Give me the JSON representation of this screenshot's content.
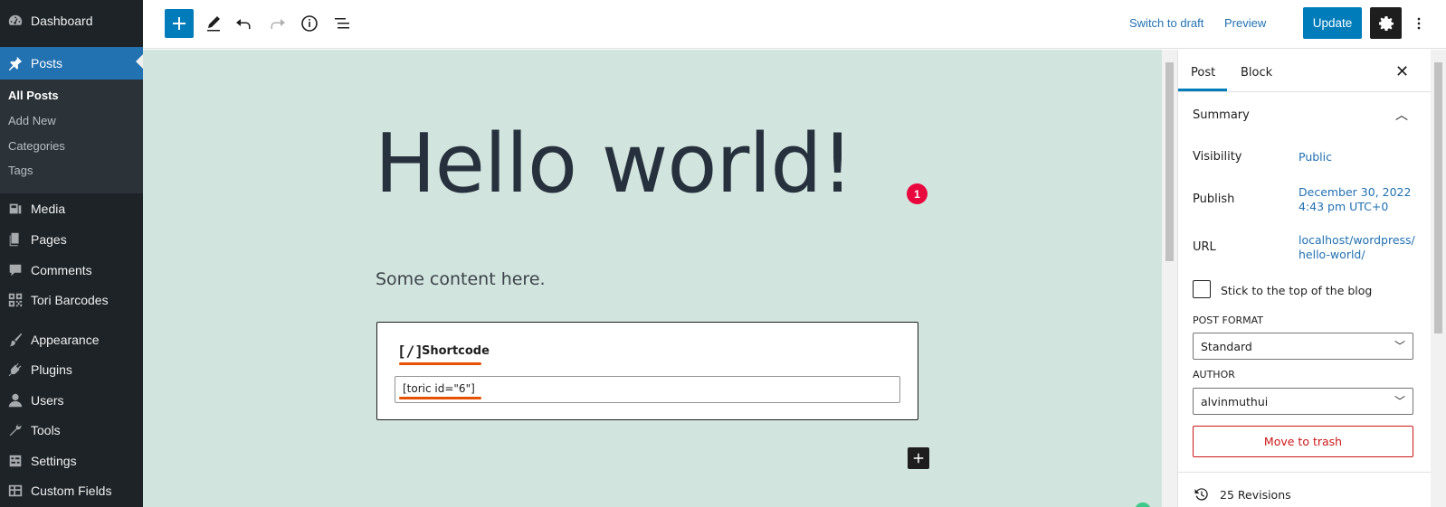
{
  "admin_menu": {
    "items": [
      {
        "label": "Dashboard",
        "icon": "dashboard-icon"
      },
      {
        "label": "Posts",
        "icon": "pin-icon"
      },
      {
        "label": "Media",
        "icon": "media-icon"
      },
      {
        "label": "Pages",
        "icon": "pages-icon"
      },
      {
        "label": "Comments",
        "icon": "comments-icon"
      },
      {
        "label": "Tori Barcodes",
        "icon": "qr-icon"
      },
      {
        "label": "Appearance",
        "icon": "brush-icon"
      },
      {
        "label": "Plugins",
        "icon": "plugin-icon"
      },
      {
        "label": "Users",
        "icon": "users-icon"
      },
      {
        "label": "Tools",
        "icon": "wrench-icon"
      },
      {
        "label": "Settings",
        "icon": "settings-icon"
      },
      {
        "label": "Custom Fields",
        "icon": "table-icon"
      }
    ],
    "submenu": [
      "All Posts",
      "Add New",
      "Categories",
      "Tags"
    ]
  },
  "toolbar": {
    "switch_to_draft": "Switch to draft",
    "preview": "Preview",
    "update": "Update"
  },
  "editor": {
    "title": "Hello world!",
    "badge": "1",
    "paragraph": "Some content here.",
    "shortcode_icon": "[/]",
    "shortcode_label": "Shortcode",
    "shortcode_value": "[toric id=\"6\"]"
  },
  "sidebar": {
    "tabs": [
      "Post",
      "Block"
    ],
    "summary_title": "Summary",
    "visibility_label": "Visibility",
    "visibility_value": "Public",
    "publish_label": "Publish",
    "publish_value_line1": "December 30, 2022",
    "publish_value_line2": "4:43 pm UTC+0",
    "url_label": "URL",
    "url_value_line1": "localhost/wordpress/",
    "url_value_line2": "hello-world/",
    "stick_label": "Stick to the top of the blog",
    "post_format_label": "POST FORMAT",
    "post_format_value": "Standard",
    "author_label": "AUTHOR",
    "author_value": "alvinmuthui",
    "trash_label": "Move to trash",
    "revisions_label": "25 Revisions"
  },
  "colors": {
    "admin_bg": "#1d2327",
    "accent": "#007cba",
    "canvas_bg": "#d2e4de",
    "annotation": "#e65100",
    "badge": "#e8083e",
    "danger": "#cc1818"
  }
}
